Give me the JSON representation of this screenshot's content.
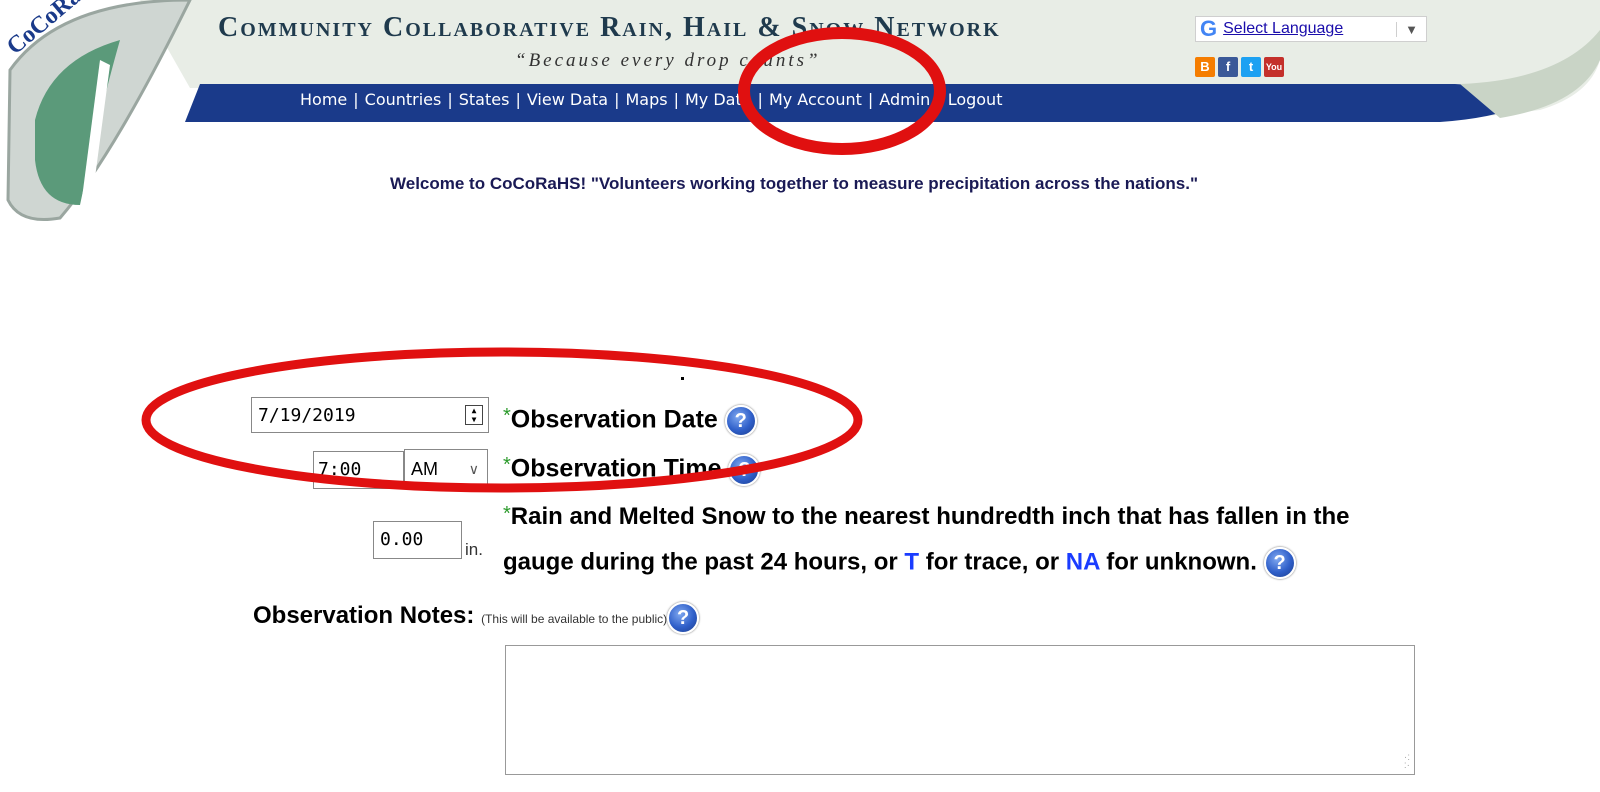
{
  "header": {
    "logo_text": "CoCoRaHS",
    "site_title": "Community Collaborative Rain, Hail & Snow Network",
    "tagline": "“Because every drop counts”",
    "nav": [
      "Home",
      "Countries",
      "States",
      "View Data",
      "Maps",
      "My Data",
      "My Account",
      "Admin",
      "Logout"
    ],
    "language": {
      "label": "Select Language",
      "arrow": "▼",
      "g": "G"
    },
    "social_icons": [
      "blogger-icon",
      "facebook-icon",
      "twitter-icon",
      "youtube-icon"
    ],
    "welcome": "Welcome to CoCoRaHS!   \"Volunteers working together to measure precipitation across the nations.\""
  },
  "form": {
    "observation_date": {
      "value": "7/19/2019",
      "label": "Observation Date",
      "required": "*"
    },
    "observation_time": {
      "value": "7:00",
      "ampm": "AM",
      "label": "Observation Time",
      "required": "*"
    },
    "precip": {
      "value": "0.00",
      "unit": "in.",
      "required": "*",
      "line1": "Rain and Melted Snow to the nearest hundredth inch that has fallen in the",
      "line2_a": "gauge during the past 24 hours, or ",
      "line2_t": "T",
      "line2_b": " for trace, or ",
      "line2_na": "NA",
      "line2_c": " for unknown."
    },
    "notes": {
      "label": "Observation Notes:",
      "hint": "(This will be available to the public)",
      "value": ""
    }
  },
  "help_icon": "?",
  "colors": {
    "nav_bar": "#1a3a8a",
    "header_bg": "#e7ece4",
    "annotation": "#e01010",
    "required": "#2a9a2a",
    "link_blue": "#1a3cff"
  }
}
